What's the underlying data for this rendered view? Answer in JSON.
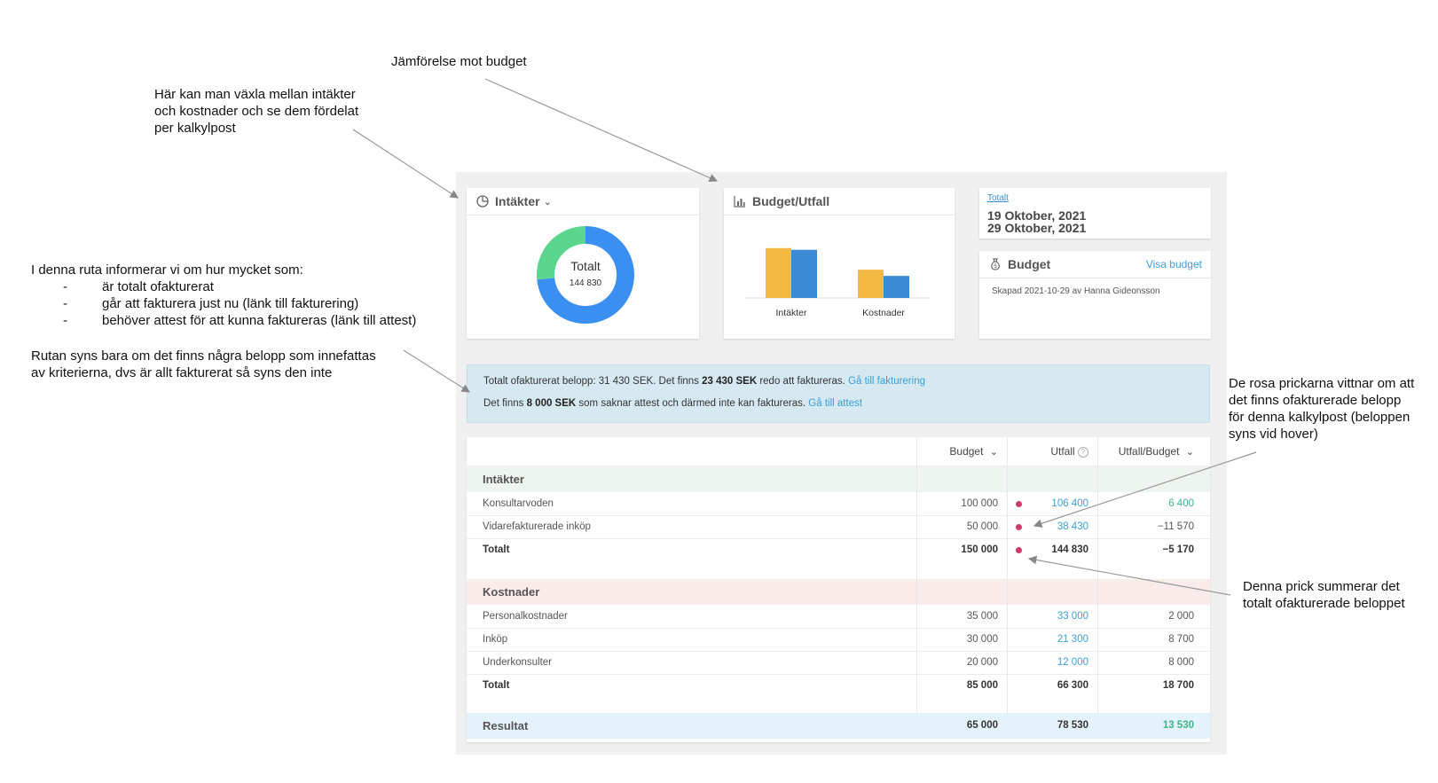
{
  "annotations": {
    "budget_compare": "Jämförelse mot budget",
    "toggle_lines": [
      "Här kan man växla mellan intäkter",
      "och kostnader och se dem fördelat",
      "per kalkylpost"
    ],
    "info_intro": "I denna ruta informerar vi om hur mycket som:",
    "info_bullets": [
      "är totalt ofakturerat",
      "går att fakturera just nu (länk till fakturering)",
      "behöver attest för att kunna faktureras (länk till attest)"
    ],
    "visibility_lines": [
      "Rutan syns bara om det finns några belopp som innefattas",
      "av kriterierna, dvs är allt fakturerat så syns den inte"
    ],
    "pink_dots_lines": [
      "De rosa prickarna vittnar om att",
      "det finns ofakturerade belopp",
      "för denna kalkylpost (beloppen",
      "syns vid hover)"
    ],
    "sum_dot_lines": [
      "Denna prick summerar det",
      "totalt ofakturerade beloppet"
    ]
  },
  "donut_card": {
    "title": "Intäkter",
    "center_label": "Totalt",
    "center_value": "144 830",
    "segments": [
      {
        "name": "Konsultarvoden",
        "value": 106400,
        "color": "#3b8ff0"
      },
      {
        "name": "Vidarefakturerade inköp",
        "value": 38430,
        "color": "#5bd68f"
      }
    ]
  },
  "chart_card": {
    "title": "Budget/Utfall",
    "chart_data": {
      "type": "bar",
      "categories": [
        "Intäkter",
        "Kostnader"
      ],
      "series": [
        {
          "values": [
            150000,
            85000
          ],
          "color": "#f4b942"
        },
        {
          "values": [
            144830,
            66300
          ],
          "color": "#3b8ad6"
        }
      ],
      "ylim": [
        0,
        160000
      ]
    }
  },
  "date_card": {
    "link": "Totalt",
    "date1": "19 Oktober, 2021",
    "date2": "29 Oktober, 2021"
  },
  "budget_card": {
    "title": "Budget",
    "link": "Visa budget",
    "meta": "Skapad 2021-10-29 av Hanna Gideonsson"
  },
  "info_box": {
    "line1_a": "Totalt ofakturerat belopp: 31 430 SEK. Det finns ",
    "line1_b": "23 430 SEK",
    "line1_c": " redo att faktureras. ",
    "line1_link": "Gå till fakturering",
    "line2_a": "Det finns ",
    "line2_b": "8 000 SEK",
    "line2_c": " som saknar attest och därmed inte kan faktureras. ",
    "line2_link": "Gå till attest"
  },
  "table": {
    "headers": {
      "budget": "Budget",
      "utfall": "Utfall",
      "ratio": "Utfall/Budget"
    },
    "income_title": "Intäkter",
    "income_rows": [
      {
        "name": "Konsultarvoden",
        "budget": "100 000",
        "utfall": "106 400",
        "diff": "6 400"
      },
      {
        "name": "Vidarefakturerade inköp",
        "budget": "50 000",
        "utfall": "38 430",
        "diff": "−11 570"
      }
    ],
    "income_total": {
      "name": "Totalt",
      "budget": "150 000",
      "utfall": "144 830",
      "diff": "−5 170"
    },
    "cost_title": "Kostnader",
    "cost_rows": [
      {
        "name": "Personalkostnader",
        "budget": "35 000",
        "utfall": "33 000",
        "diff": "2 000"
      },
      {
        "name": "Inköp",
        "budget": "30 000",
        "utfall": "21 300",
        "diff": "8 700"
      },
      {
        "name": "Underkonsulter",
        "budget": "20 000",
        "utfall": "12 000",
        "diff": "8 000"
      }
    ],
    "cost_total": {
      "name": "Totalt",
      "budget": "85 000",
      "utfall": "66 300",
      "diff": "18 700"
    },
    "result": {
      "name": "Resultat",
      "budget": "65 000",
      "utfall": "78 530",
      "diff": "13 530"
    }
  }
}
